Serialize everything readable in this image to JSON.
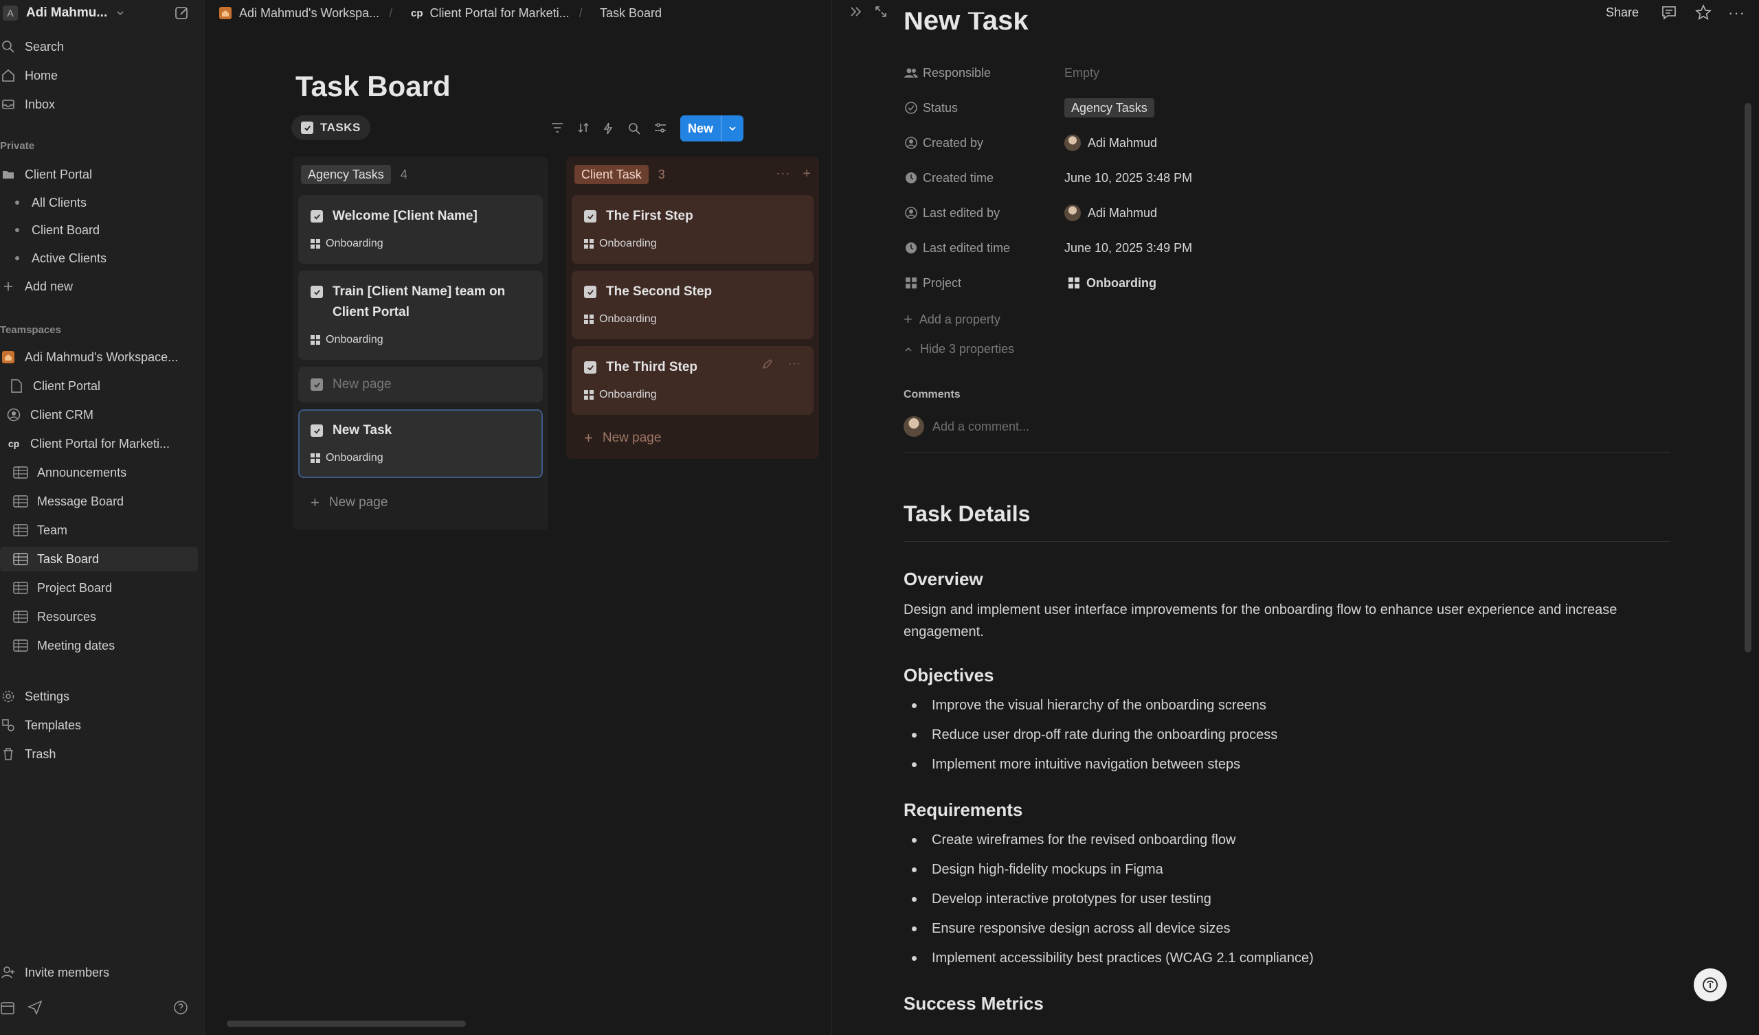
{
  "workspace": {
    "badge": "A",
    "name": "Adi Mahmu..."
  },
  "sidebar": {
    "top": [
      {
        "label": "Search",
        "icon": "search-icon"
      },
      {
        "label": "Home",
        "icon": "home-icon"
      },
      {
        "label": "Inbox",
        "icon": "inbox-icon"
      }
    ],
    "private_label": "Private",
    "private": [
      {
        "label": "Client Portal",
        "type": "folder"
      },
      {
        "label": "All Clients",
        "type": "sub"
      },
      {
        "label": "Client Board",
        "type": "sub"
      },
      {
        "label": "Active Clients",
        "type": "sub"
      },
      {
        "label": "Add new",
        "type": "add"
      }
    ],
    "teamspaces_label": "Teamspaces",
    "teamspaces": [
      {
        "label": "Adi Mahmud's Workspace...",
        "icon": "home-icon"
      },
      {
        "label": "Client Portal",
        "icon": "page-icon"
      },
      {
        "label": "Client CRM",
        "icon": "user-icon"
      },
      {
        "label": "Client Portal for Marketi...",
        "icon": "cp-icon"
      },
      {
        "label": "Announcements",
        "icon": "table-icon"
      },
      {
        "label": "Message Board",
        "icon": "table-icon"
      },
      {
        "label": "Team",
        "icon": "table-icon"
      },
      {
        "label": "Task Board",
        "icon": "table-icon",
        "active": true
      },
      {
        "label": "Project Board",
        "icon": "table-icon"
      },
      {
        "label": "Resources",
        "icon": "table-icon"
      },
      {
        "label": "Meeting dates",
        "icon": "table-icon"
      }
    ],
    "bottom": [
      {
        "label": "Settings",
        "icon": "gear-icon"
      },
      {
        "label": "Templates",
        "icon": "templates-icon"
      },
      {
        "label": "Trash",
        "icon": "trash-icon"
      }
    ],
    "invite": "Invite members"
  },
  "breadcrumb": [
    {
      "label": "Adi Mahmud's Workspa..."
    },
    {
      "label": "Client Portal for Marketi...",
      "prefix": "cp"
    },
    {
      "label": "Task Board"
    }
  ],
  "board": {
    "title": "Task Board",
    "view_tab": "TASKS",
    "new_label": "New",
    "columns": [
      {
        "name": "Agency Tasks",
        "count": "4",
        "cards": [
          {
            "title": "Welcome [Client Name]",
            "project": "Onboarding"
          },
          {
            "title": "Train [Client Name] team on Client Portal",
            "project": "Onboarding"
          },
          {
            "title": "New page",
            "project": ""
          },
          {
            "title": "New Task",
            "project": "Onboarding"
          }
        ],
        "add_label": "New page"
      },
      {
        "name": "Client Task",
        "count": "3",
        "cards": [
          {
            "title": "The First Step",
            "project": "Onboarding"
          },
          {
            "title": "The Second Step",
            "project": "Onboarding"
          },
          {
            "title": "The Third Step",
            "project": "Onboarding"
          }
        ],
        "add_label": "New page"
      }
    ]
  },
  "panel": {
    "share": "Share",
    "title": "New Task",
    "properties": [
      {
        "name": "Responsible",
        "value": "Empty",
        "icon": "people-icon"
      },
      {
        "name": "Status",
        "value": "Agency Tasks",
        "icon": "status-icon"
      },
      {
        "name": "Created by",
        "value": "Adi Mahmud",
        "icon": "user-circle-icon"
      },
      {
        "name": "Created time",
        "value": "June 10, 2025 3:48 PM",
        "icon": "clock-icon"
      },
      {
        "name": "Last edited by",
        "value": "Adi Mahmud",
        "icon": "user-circle-icon"
      },
      {
        "name": "Last edited time",
        "value": "June 10, 2025 3:49 PM",
        "icon": "clock-icon"
      },
      {
        "name": "Project",
        "value": "Onboarding",
        "icon": "grid-icon"
      }
    ],
    "add_property": "Add a property",
    "hide_properties": "Hide 3 properties",
    "comments_label": "Comments",
    "comment_placeholder": "Add a comment...",
    "doc": {
      "heading": "Task Details",
      "overview_h": "Overview",
      "overview": "Design and implement user interface improvements for the onboarding flow to enhance user experience and increase engagement.",
      "objectives_h": "Objectives",
      "objectives": [
        "Improve the visual hierarchy of the onboarding screens",
        "Reduce user drop-off rate during the onboarding process",
        "Implement more intuitive navigation between steps"
      ],
      "requirements_h": "Requirements",
      "requirements": [
        "Create wireframes for the revised onboarding flow",
        "Design high-fidelity mockups in Figma",
        "Develop interactive prototypes for user testing",
        "Ensure responsive design across all device sizes",
        "Implement accessibility best practices (WCAG 2.1 compliance)"
      ],
      "success_h": "Success Metrics"
    }
  },
  "colors": {
    "accent": "#2383e2",
    "client_column": "#2a1e1b",
    "client_card": "#3f2a24",
    "client_tag": "#6b3e2d"
  }
}
